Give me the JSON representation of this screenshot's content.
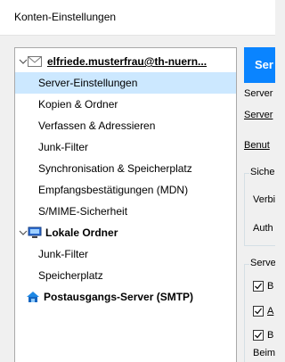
{
  "window": {
    "title": "Konten-Einstellungen"
  },
  "tree": {
    "account": "elfriede.musterfrau@th-nuern...",
    "items": [
      "Server-Einstellungen",
      "Kopien & Ordner",
      "Verfassen & Adressieren",
      "Junk-Filter",
      "Synchronisation & Speicherplatz",
      "Empfangsbestätigungen (MDN)",
      "S/MIME-Sicherheit"
    ],
    "local_folders": "Lokale Ordner",
    "local_items": [
      "Junk-Filter",
      "Speicherplatz"
    ],
    "smtp": "Postausgangs-Server (SMTP)"
  },
  "right": {
    "banner": "Ser",
    "line1": "Server",
    "line2": "Server",
    "line3": "Benut",
    "security_group": "Siche",
    "security_conn": "Verbi",
    "security_auth": "Auth",
    "server_group": "Serve",
    "check1": "B",
    "check2": "A",
    "check3": "B",
    "last": "Beim"
  },
  "colors": {
    "selection": "#cce8ff",
    "banner": "#0a84ff"
  },
  "icons": [
    "chevron-down-icon",
    "envelope-icon",
    "local-folders-icon",
    "smtp-server-icon",
    "checkbox-checked-icon"
  ]
}
